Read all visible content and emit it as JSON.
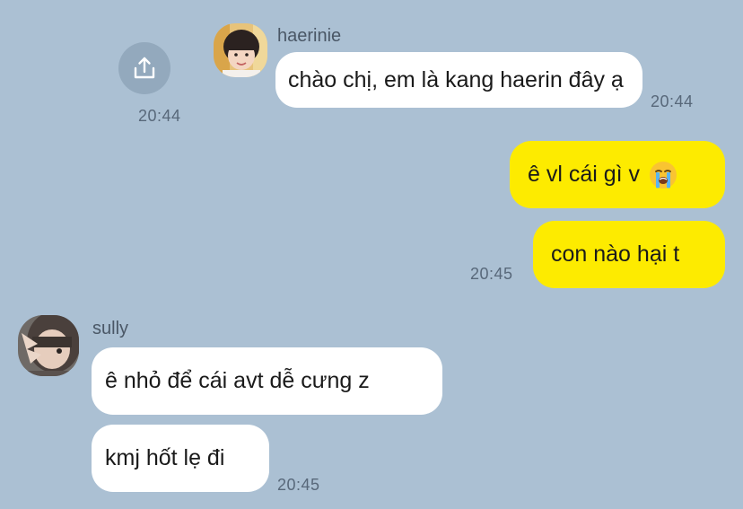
{
  "colors": {
    "background": "#abc0d3",
    "incoming_bubble": "#ffffff",
    "outgoing_bubble": "#fdeb00",
    "timestamp": "#58687a"
  },
  "share": {
    "icon": "share-icon",
    "time": "20:44"
  },
  "messages": [
    {
      "sender": "haerinie",
      "avatar_icon": "avatar-haerinie",
      "direction": "incoming",
      "text": "chào chị, em là kang haerin đây ạ",
      "time": "20:44"
    },
    {
      "direction": "outgoing",
      "text": "ê vl cái gì v",
      "emoji": "loudly-crying-face-icon"
    },
    {
      "direction": "outgoing",
      "text": "con nào hại t",
      "time": "20:45"
    },
    {
      "sender": "sully",
      "avatar_icon": "avatar-sully",
      "direction": "incoming",
      "text": "ê nhỏ để cái avt dễ cưng z"
    },
    {
      "direction": "incoming",
      "text": "kmj hốt lẹ đi",
      "time": "20:45"
    }
  ]
}
